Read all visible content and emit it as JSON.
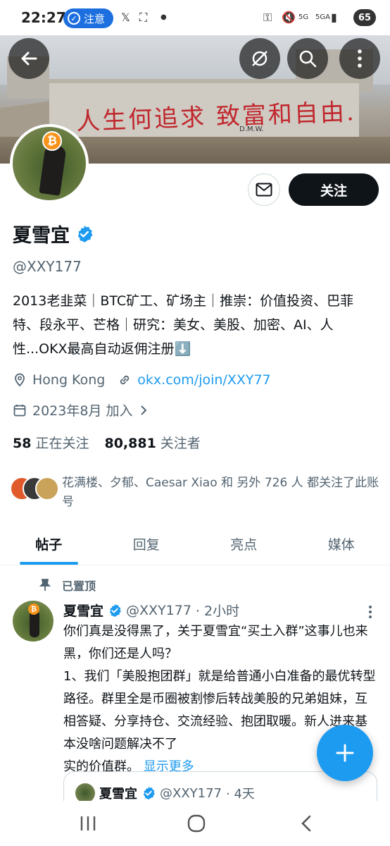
{
  "status_bar": {
    "time": "22:27",
    "notice_label": "注意",
    "battery": "65",
    "network_a": "5G",
    "network_b": "5GA"
  },
  "banner": {
    "slogan": "人生何追求 致富和自由.",
    "signature": "D.M.W."
  },
  "profile": {
    "display_name": "夏雪宜",
    "handle": "@XXY177",
    "follow_button": "关注",
    "bio": "2013老韭菜｜BTC矿工、矿场主｜推崇：价值投资、巴菲特、段永平、芒格｜研究：美女、美股、加密、AI、人性...OKX最高自动返佣注册⬇️",
    "location": "Hong Kong",
    "link": "okx.com/join/XXY77",
    "joined": "2023年8月 加入",
    "following_count": "58",
    "following_label": "正在关注",
    "followers_count": "80,881",
    "followers_label": "关注者",
    "mutuals_text": "花满楼、夕郁、Caesar Xiao 和 另外 726 人 都关注了此账号"
  },
  "tabs": [
    {
      "label": "帖子",
      "active": true
    },
    {
      "label": "回复",
      "active": false
    },
    {
      "label": "亮点",
      "active": false
    },
    {
      "label": "媒体",
      "active": false
    }
  ],
  "pinned_post": {
    "pinned_label": "已置顶",
    "author_name": "夏雪宜",
    "author_handle": "@XXY177",
    "time": "· 2小时",
    "body": "你们真是没得黑了，关于夏雪宜“买土入群”这事儿也来黑，你们还是人吗？\n1、我们「美股抱团群」就是给普通小白准备的最优转型路径。群里全是币圈被割惨后转战美股的兄弟姐妹，互相答疑、分享持仓、交流经验、抱团取暖。新人进来基本没啥问题解决不了",
    "body_tail": "实的价值群。",
    "show_more": "显示更多",
    "quote": {
      "author_name": "夏雪宜",
      "author_handle": "@XXY177",
      "time": "· 4天"
    }
  },
  "colors": {
    "accent": "#1d9bf0",
    "text": "#0f1419",
    "muted": "#536471",
    "btc": "#f7931a",
    "banner_slogan": "#c1272d"
  },
  "icons": [
    "back-arrow-icon",
    "no-view-icon",
    "search-icon",
    "more-vertical-icon",
    "mail-icon",
    "verified-badge-icon",
    "location-pin-icon",
    "link-icon",
    "calendar-icon",
    "chevron-right-icon",
    "pin-icon",
    "plus-icon",
    "recents-icon",
    "home-icon",
    "back-icon"
  ]
}
